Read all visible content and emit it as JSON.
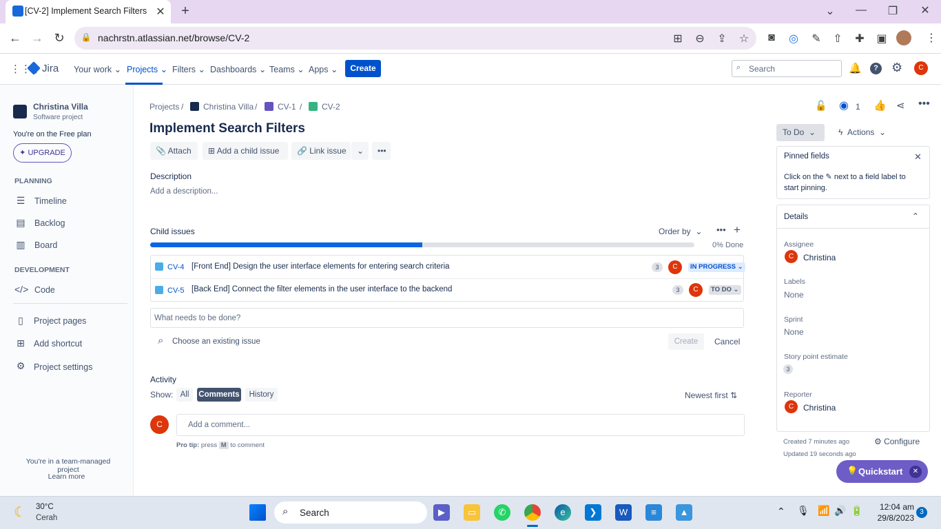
{
  "browser": {
    "tab_title": "[CV-2] Implement Search Filters",
    "url": "nachrstn.atlassian.net/browse/CV-2"
  },
  "nav": {
    "product": "Jira",
    "items": [
      "Your work",
      "Projects",
      "Filters",
      "Dashboards",
      "Teams",
      "Apps"
    ],
    "create_label": "Create",
    "search_placeholder": "Search",
    "user_initial": "C"
  },
  "sidebar": {
    "project_name": "Christina Villa",
    "project_type": "Software project",
    "plan_text": "You're on the Free plan",
    "upgrade_label": "UPGRADE",
    "planning_heading": "PLANNING",
    "planning_items": [
      "Timeline",
      "Backlog",
      "Board"
    ],
    "development_heading": "DEVELOPMENT",
    "development_items": [
      "Code"
    ],
    "other_items": [
      "Project pages",
      "Add shortcut",
      "Project settings"
    ],
    "footer_text": "You're in a team-managed project",
    "learn_more": "Learn more"
  },
  "issue": {
    "breadcrumb": [
      "Projects",
      "Christina Villa",
      "CV-1",
      "CV-2"
    ],
    "title": "Implement Search Filters",
    "toolbar": {
      "attach": "Attach",
      "add_child": "Add a child issue",
      "link": "Link issue"
    },
    "description_label": "Description",
    "description_placeholder": "Add a description...",
    "watchers": "1"
  },
  "child_issues": {
    "label": "Child issues",
    "order_by": "Order by",
    "progress_percent": 50,
    "done_text": "0% Done",
    "items": [
      {
        "key": "CV-4",
        "summary": "[Front End] Design the user interface elements for entering search criteria",
        "points": "3",
        "assignee": "C",
        "status": "IN PROGRESS",
        "status_color": "#0052cc",
        "status_bg": "#deebff"
      },
      {
        "key": "CV-5",
        "summary": "[Back End] Connect the filter elements in the user interface to the backend",
        "points": "3",
        "assignee": "C",
        "status": "TO DO",
        "status_color": "#42526e",
        "status_bg": "#dfe1e6"
      }
    ],
    "new_placeholder": "What needs to be done?",
    "choose_existing": "Choose an existing issue",
    "create_label": "Create",
    "cancel_label": "Cancel"
  },
  "activity": {
    "label": "Activity",
    "show_label": "Show:",
    "filters": [
      "All",
      "Comments",
      "History"
    ],
    "selected_filter": "Comments",
    "sort": "Newest first",
    "comment_placeholder": "Add a comment...",
    "pro_tip_prefix": "Pro tip:",
    "pro_tip_press": "press",
    "pro_tip_key": "M",
    "pro_tip_suffix": "to comment"
  },
  "right_panel": {
    "status": "To Do",
    "actions": "Actions",
    "pinned_title": "Pinned fields",
    "pinned_text_1": "Click on the",
    "pinned_text_2": "next to a field label to",
    "pinned_text_3": "start pinning.",
    "details_title": "Details",
    "fields": [
      {
        "label": "Assignee",
        "value": "Christina"
      },
      {
        "label": "Labels",
        "value": "None"
      },
      {
        "label": "Sprint",
        "value": "None"
      },
      {
        "label": "Story point estimate",
        "value": "3"
      },
      {
        "label": "Reporter",
        "value": "Christina"
      }
    ],
    "created": "Created 7 minutes ago",
    "updated": "Updated 19 seconds ago",
    "configure": "Configure",
    "quickstart": "Quickstart"
  },
  "taskbar": {
    "temp": "30°C",
    "weather": "Cerah",
    "search": "Search",
    "time": "12:04 am",
    "date": "29/8/2023",
    "notifications": "3"
  },
  "colors": {
    "brand": "#0052cc",
    "avatar": "#de350b",
    "quickstart": "#6e5dc6"
  }
}
